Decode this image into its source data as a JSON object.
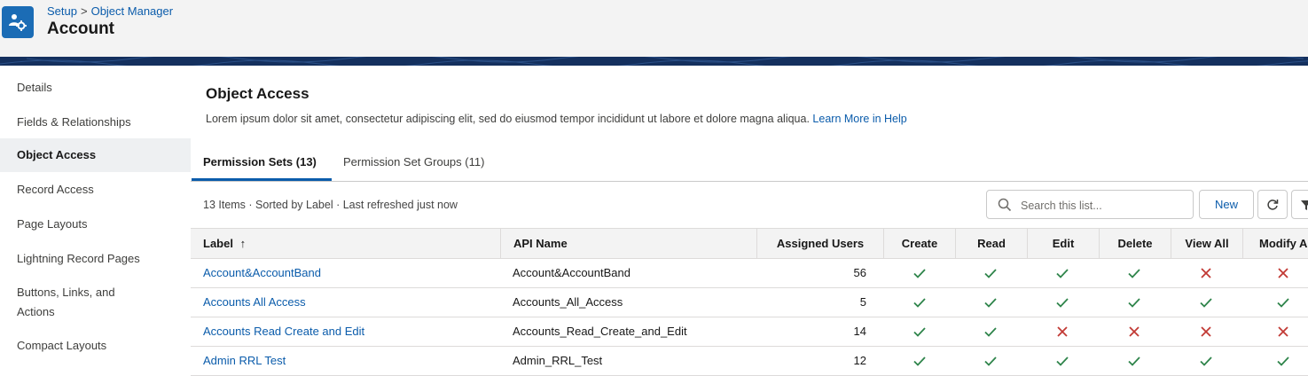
{
  "header": {
    "breadcrumb": [
      "Setup",
      "Object Manager"
    ],
    "breadcrumb_sep": ">",
    "title": "Account"
  },
  "sidebar": {
    "items": [
      {
        "label": "Details",
        "active": false
      },
      {
        "label": "Fields & Relationships",
        "active": false
      },
      {
        "label": "Object Access",
        "active": true
      },
      {
        "label": "Record Access",
        "active": false
      },
      {
        "label": "Page Layouts",
        "active": false
      },
      {
        "label": "Lightning Record Pages",
        "active": false
      },
      {
        "label": "Buttons, Links, and Actions",
        "active": false
      },
      {
        "label": "Compact Layouts",
        "active": false
      }
    ]
  },
  "main": {
    "title": "Object Access",
    "description": "Lorem ipsum dolor sit amet, consectetur adipiscing elit, sed do eiusmod tempor incididunt ut labore et dolore magna aliqua.",
    "help_link": "Learn More in Help",
    "tabs": [
      {
        "label": "Permission Sets (13)",
        "active": true
      },
      {
        "label": "Permission Set Groups (11)",
        "active": false
      }
    ],
    "list_info": "13 Items · Sorted by Label · Last refreshed just now",
    "search_placeholder": "Search this list...",
    "new_button": "New",
    "refresh_icon": "refresh-icon",
    "filter_icon": "filter-icon",
    "sort_indicator": "↑"
  },
  "colors": {
    "link": "#0b5cab",
    "check": "#2e844a",
    "cross": "#c23934",
    "header_band": "#14305e"
  },
  "table": {
    "columns": [
      "Label",
      "API Name",
      "Assigned Users",
      "Create",
      "Read",
      "Edit",
      "Delete",
      "View All",
      "Modify A"
    ],
    "rows": [
      {
        "label": "Account&AccountBand",
        "api": "Account&AccountBand",
        "users": "56",
        "perms": [
          true,
          true,
          true,
          true,
          false,
          false
        ]
      },
      {
        "label": "Accounts All Access",
        "api": "Accounts_All_Access",
        "users": "5",
        "perms": [
          true,
          true,
          true,
          true,
          true,
          true
        ]
      },
      {
        "label": "Accounts Read Create and Edit",
        "api": "Accounts_Read_Create_and_Edit",
        "users": "14",
        "perms": [
          true,
          true,
          false,
          false,
          false,
          false
        ]
      },
      {
        "label": "Admin RRL Test",
        "api": "Admin_RRL_Test",
        "users": "12",
        "perms": [
          true,
          true,
          true,
          true,
          true,
          true
        ]
      }
    ]
  }
}
